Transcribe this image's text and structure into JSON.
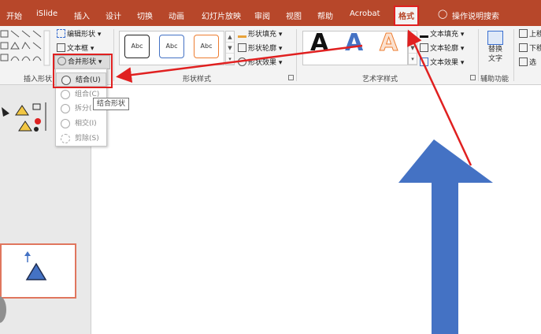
{
  "tabs": [
    "开始",
    "iSlide",
    "插入",
    "设计",
    "切换",
    "动画",
    "幻灯片放映",
    "审阅",
    "视图",
    "帮助",
    "Acrobat",
    "格式"
  ],
  "tell_me": "操作说明搜索",
  "ribbon": {
    "insert_shapes": {
      "edit_shape": "编辑形状",
      "text_box": "文本框",
      "merge_shapes": "合并形状",
      "group_label": "插入形状"
    },
    "shape_styles": {
      "samples": [
        "Abc",
        "Abc",
        "Abc"
      ],
      "fill": "形状填充",
      "outline": "形状轮廓",
      "effects": "形状效果",
      "group_label": "形状样式"
    },
    "wordart": {
      "letters": [
        "A",
        "A",
        "A"
      ],
      "text_fill": "文本填充",
      "text_outline": "文本轮廓",
      "text_effects": "文本效果",
      "group_label": "艺术字样式"
    },
    "accessibility": {
      "alt_text_line1": "替换",
      "alt_text_line2": "文字",
      "group_label": "辅助功能"
    },
    "arrange": {
      "bring_forward": "上移",
      "send_backward": "下移",
      "selection": "选"
    }
  },
  "merge_menu": {
    "items": [
      "结合(U)",
      "组合(C)",
      "拆分(",
      "相交(I)",
      "剪除(S)"
    ]
  },
  "tooltip": "结合形状",
  "colors": {
    "ribbon_red": "#b7472a",
    "annotation_red": "#e02020",
    "arrow_blue": "#4472c4"
  },
  "icons": [
    "lightbulb-icon",
    "edit-shape-icon",
    "text-box-icon",
    "merge-shapes-icon",
    "shape-fill-icon",
    "shape-outline-icon",
    "shape-effects-icon",
    "text-fill-icon",
    "text-outline-icon",
    "text-effects-icon",
    "alt-text-icon",
    "dialog-launcher-icon"
  ]
}
